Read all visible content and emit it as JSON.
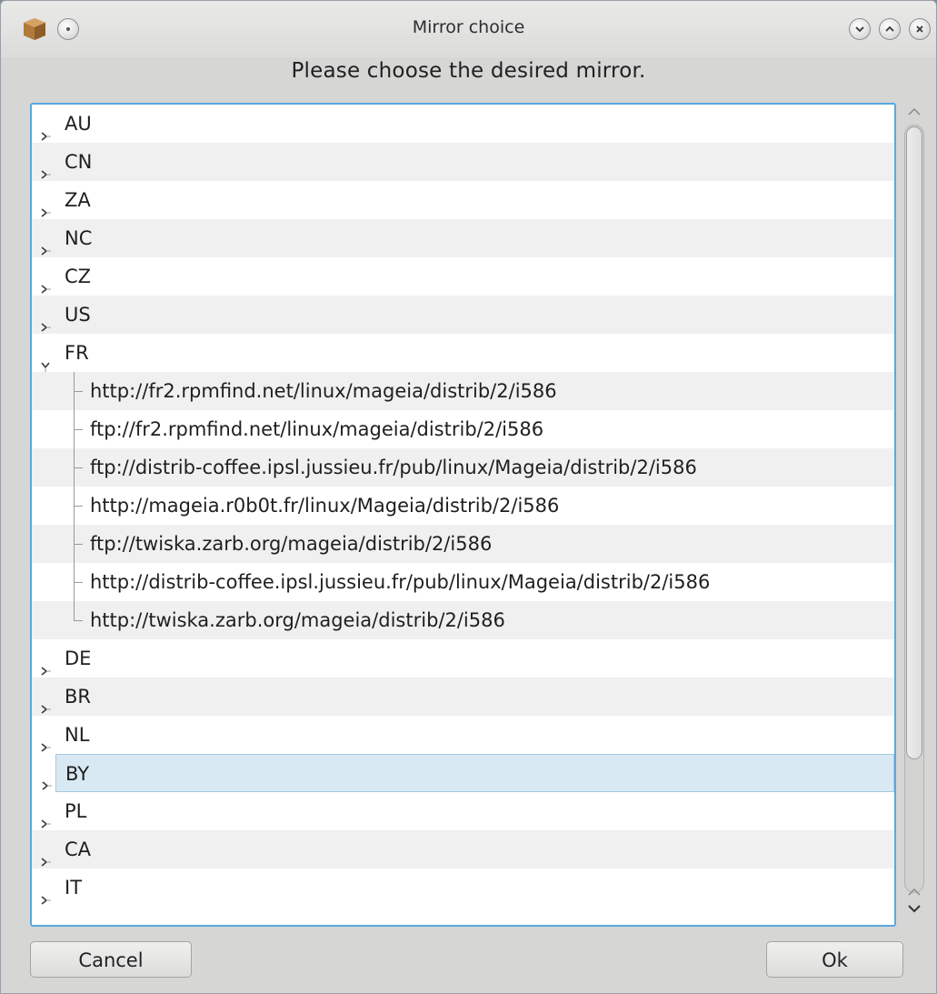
{
  "window": {
    "title": "Mirror choice"
  },
  "prompt": "Please choose the desired mirror.",
  "tree": {
    "countries_before": [
      "AU",
      "CN",
      "ZA",
      "NC",
      "CZ",
      "US"
    ],
    "expanded_country": "FR",
    "expanded_children": [
      "http://fr2.rpmfind.net/linux/mageia/distrib/2/i586",
      "ftp://fr2.rpmfind.net/linux/mageia/distrib/2/i586",
      "ftp://distrib-coffee.ipsl.jussieu.fr/pub/linux/Mageia/distrib/2/i586",
      "http://mageia.r0b0t.fr/linux/Mageia/distrib/2/i586",
      "ftp://twiska.zarb.org/mageia/distrib/2/i586",
      "http://distrib-coffee.ipsl.jussieu.fr/pub/linux/Mageia/distrib/2/i586",
      "http://twiska.zarb.org/mageia/distrib/2/i586"
    ],
    "countries_after": [
      "DE",
      "BR",
      "NL",
      "BY",
      "PL",
      "CA",
      "IT"
    ],
    "selected": "BY"
  },
  "buttons": {
    "cancel": "Cancel",
    "ok": "Ok"
  },
  "colors": {
    "focus_border": "#58a9df",
    "selection": "#d9e9f3",
    "alt_row": "#f0f0f0"
  },
  "icons": {
    "app": "package-icon",
    "window_menu": "circle-menu-icon",
    "minimize": "chevron-down-icon",
    "maximize": "chevron-up-icon",
    "close": "close-icon"
  }
}
